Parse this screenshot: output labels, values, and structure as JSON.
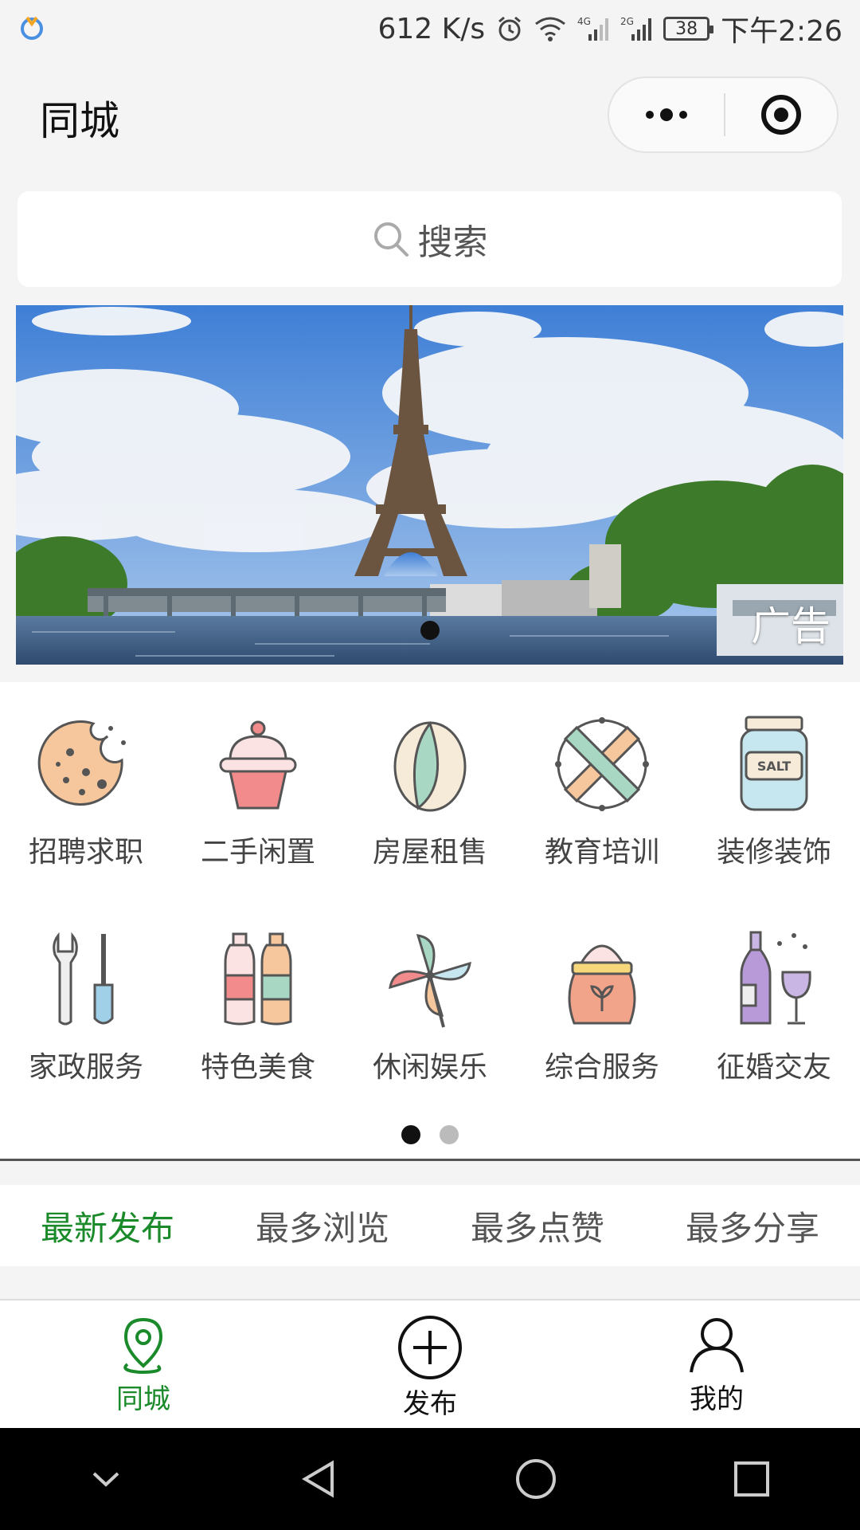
{
  "status_bar": {
    "speed": "612 K/s",
    "signal_4g": "4G",
    "signal_2g": "2G",
    "battery": "38",
    "time": "下午2:26"
  },
  "header": {
    "title": "同城"
  },
  "search": {
    "placeholder": "搜索"
  },
  "banner": {
    "ad_label": "广告"
  },
  "categories": [
    {
      "label": "招聘求职",
      "icon": "cookie-icon"
    },
    {
      "label": "二手闲置",
      "icon": "cupcake-icon"
    },
    {
      "label": "房屋租售",
      "icon": "pistachio-icon"
    },
    {
      "label": "教育培训",
      "icon": "ruler-pencil-icon"
    },
    {
      "label": "装修装饰",
      "icon": "salt-jar-icon"
    },
    {
      "label": "家政服务",
      "icon": "tools-icon"
    },
    {
      "label": "特色美食",
      "icon": "bottles-icon"
    },
    {
      "label": "休闲娱乐",
      "icon": "pinwheel-icon"
    },
    {
      "label": "综合服务",
      "icon": "flour-sack-icon"
    },
    {
      "label": "征婚交友",
      "icon": "wine-icon"
    }
  ],
  "salt_label": "SALT",
  "sort_tabs": [
    {
      "label": "最新发布"
    },
    {
      "label": "最多浏览"
    },
    {
      "label": "最多点赞"
    },
    {
      "label": "最多分享"
    }
  ],
  "bottom_nav": [
    {
      "label": "同城",
      "icon": "location-icon"
    },
    {
      "label": "发布",
      "icon": "add-circle-icon"
    },
    {
      "label": "我的",
      "icon": "user-icon"
    }
  ],
  "colors": {
    "accent": "#1a8a2a",
    "background": "#f4f4f4"
  }
}
